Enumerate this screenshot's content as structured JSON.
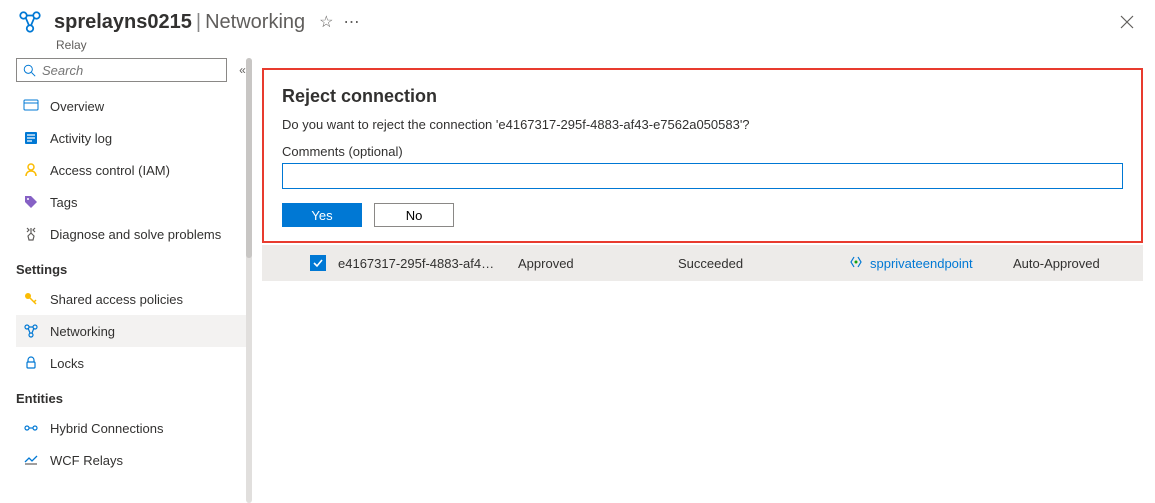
{
  "header": {
    "resource_name": "sprelayns0215",
    "section": "Networking",
    "resource_type": "Relay"
  },
  "search": {
    "placeholder": "Search"
  },
  "sidebar": {
    "items": [
      {
        "label": "Overview"
      },
      {
        "label": "Activity log"
      },
      {
        "label": "Access control (IAM)"
      },
      {
        "label": "Tags"
      },
      {
        "label": "Diagnose and solve problems"
      }
    ],
    "section_settings": "Settings",
    "settings_items": [
      {
        "label": "Shared access policies"
      },
      {
        "label": "Networking"
      },
      {
        "label": "Locks"
      }
    ],
    "section_entities": "Entities",
    "entities_items": [
      {
        "label": "Hybrid Connections"
      },
      {
        "label": "WCF Relays"
      }
    ]
  },
  "dialog": {
    "title": "Reject connection",
    "message": "Do you want to reject the connection 'e4167317-295f-4883-af43-e7562a050583'?",
    "comments_label": "Comments (optional)",
    "comments_value": "",
    "yes_label": "Yes",
    "no_label": "No"
  },
  "row": {
    "connection": "e4167317-295f-4883-af4…",
    "state": "Approved",
    "provisioning": "Succeeded",
    "endpoint": "spprivateendpoint",
    "description": "Auto-Approved"
  }
}
